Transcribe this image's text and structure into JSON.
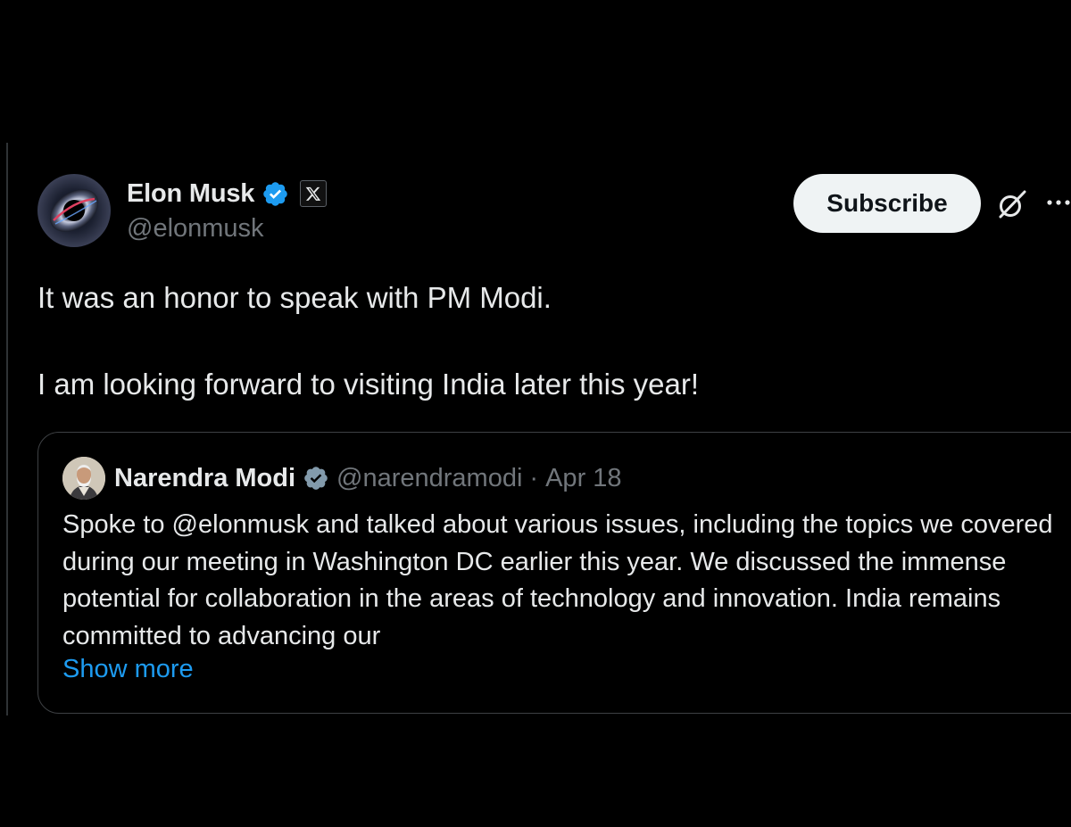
{
  "author": {
    "display_name": "Elon Musk",
    "handle": "@elonmusk",
    "verified": true,
    "affiliate_badge": "x-logo-icon"
  },
  "actions": {
    "subscribe_label": "Subscribe",
    "grok_icon": "grok-icon",
    "more_icon": "more-icon"
  },
  "tweet": {
    "paragraphs": [
      "It was an honor to speak with PM Modi.",
      "I am looking forward to visiting India later this year!"
    ]
  },
  "quote": {
    "display_name": "Narendra Modi",
    "handle": "@narendramodi",
    "separator": "·",
    "date": "Apr 18",
    "verified": true,
    "text": "Spoke to @elonmusk and talked about various issues, including the topics we covered during our meeting in Washington DC earlier this year. We discussed the immense potential for collaboration in the areas of technology and innovation. India remains committed to advancing our",
    "show_more": "Show more"
  },
  "colors": {
    "background": "#000000",
    "text_primary": "#e7e9ea",
    "text_secondary": "#71767b",
    "link": "#1d9bf0",
    "verified_badge": "#1d9bf0",
    "quote_verified_badge": "#829aab",
    "subscribe_bg": "#eff3f4",
    "border": "#3e4144"
  }
}
